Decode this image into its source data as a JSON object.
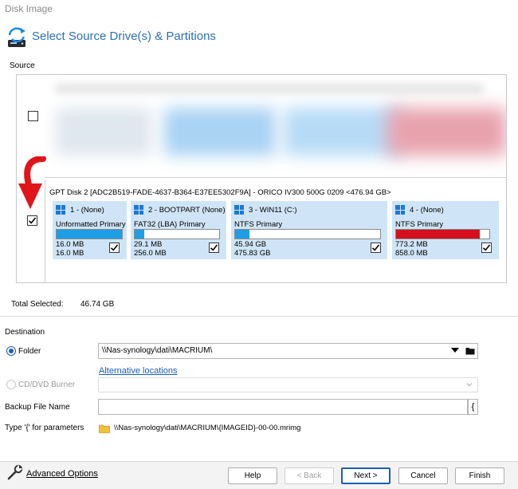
{
  "window": {
    "title": "Disk Image"
  },
  "header": {
    "title": "Select Source Drive(s) & Partitions"
  },
  "source": {
    "label": "Source",
    "disk1": {
      "checked": false
    },
    "disk2": {
      "title": "GPT Disk 2 [ADC2B519-FADE-4637-B364-E37EE5302F9A] - ORICO    IV300 500G         0209  <476.94 GB>",
      "checked": true,
      "partitions": [
        {
          "name": "1 -  (None)",
          "type": "Unformatted Primary",
          "used": "16.0 MB",
          "total": "16.0 MB",
          "fill": 1.0,
          "fill_color": "#1e9ee6",
          "checked": true
        },
        {
          "name": "2 - BOOTPART (None)",
          "type": "FAT32 (LBA) Primary",
          "used": "29.1 MB",
          "total": "256.0 MB",
          "fill": 0.11,
          "fill_color": "#1e9ee6",
          "checked": true
        },
        {
          "name": "3 - WIN11 (C:)",
          "type": "NTFS Primary",
          "used": "45.94 GB",
          "total": "475.83 GB",
          "fill": 0.097,
          "fill_color": "#1e9ee6",
          "checked": true
        },
        {
          "name": "4 -  (None)",
          "type": "NTFS Primary",
          "used": "773.2 MB",
          "total": "858.0 MB",
          "fill": 0.9,
          "fill_color": "#d4101e",
          "checked": true
        }
      ]
    }
  },
  "total": {
    "label": "Total Selected:",
    "value": "46.74 GB"
  },
  "destination": {
    "label": "Destination",
    "folder_label": "Folder",
    "folder_value": "\\\\Nas-synology\\dati\\MACRIUM\\",
    "alt_locations": "Alternative locations",
    "cd_label": "CD/DVD Burner",
    "backup_label": "Backup File Name",
    "brace": "{",
    "param_label": "Type '{' for parameters",
    "param_value": "\\\\Nas-synology\\dati\\MACRIUM\\{IMAGEID}-00-00.mrimg"
  },
  "footer": {
    "advanced": "Advanced Options",
    "help": "Help",
    "back": "< Back",
    "next": "Next >",
    "cancel": "Cancel",
    "finish": "Finish"
  },
  "colors": {
    "accent": "#2e6fb6",
    "partition_bg": "#cfe5f7",
    "arrow": "#e0151b"
  }
}
